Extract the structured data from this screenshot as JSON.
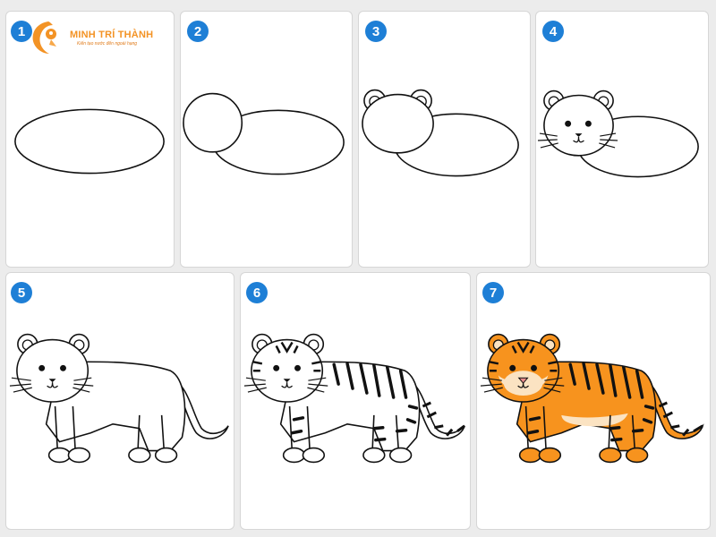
{
  "logo": {
    "title": "MINH TRÍ THÀNH",
    "subtitle": "Kiến tạo nước đến ngoài hạng"
  },
  "steps": [
    {
      "number": "1"
    },
    {
      "number": "2"
    },
    {
      "number": "3"
    },
    {
      "number": "4"
    },
    {
      "number": "5"
    },
    {
      "number": "6"
    },
    {
      "number": "7"
    }
  ],
  "colors": {
    "badge": "#1e7fd6",
    "tiger_orange": "#f7931e",
    "tiger_cream": "#fbe3c2",
    "stripe": "#1a1a1a",
    "logo_orange": "#f39325"
  }
}
